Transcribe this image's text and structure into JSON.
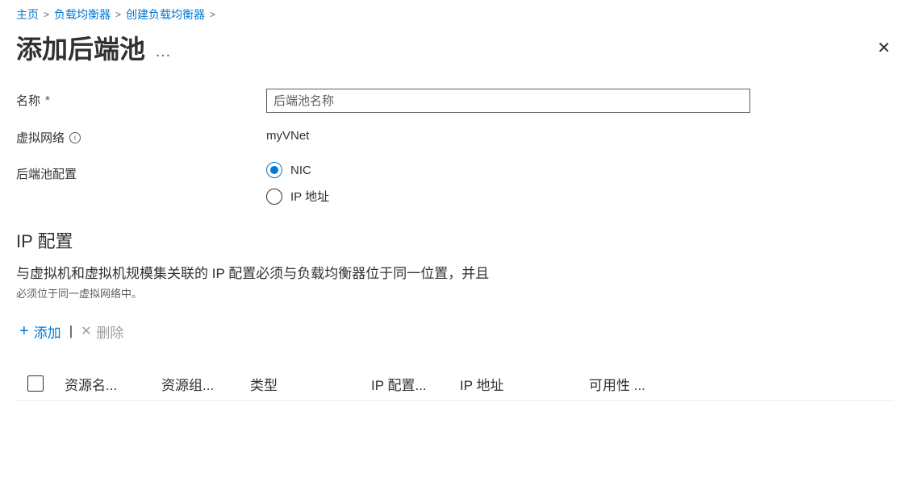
{
  "breadcrumb": {
    "home": "主页",
    "lb": "负载均衡器",
    "create_lb": "创建负载均衡器"
  },
  "title": "添加后端池",
  "form": {
    "name_label": "名称",
    "name_placeholder": "后端池名称",
    "vnet_label": "虚拟网络",
    "vnet_value": "myVNet",
    "config_label": "后端池配置",
    "radio_nic": "NIC",
    "radio_ip": "IP 地址"
  },
  "ip_section": {
    "heading": "IP 配置",
    "desc1": "与虚拟机和虚拟机规模集关联的 IP 配置必须与负载均衡器位于同一位置，并且",
    "desc2": "必须位于同一虚拟网络中。"
  },
  "toolbar": {
    "add": "添加",
    "remove": "删除"
  },
  "table": {
    "col_resource_name": "资源名...",
    "col_resource_group": "资源组...",
    "col_type": "类型",
    "col_ip_config": "IP 配置...",
    "col_ip_addr": "IP 地址",
    "col_availability": "可用性 ..."
  }
}
